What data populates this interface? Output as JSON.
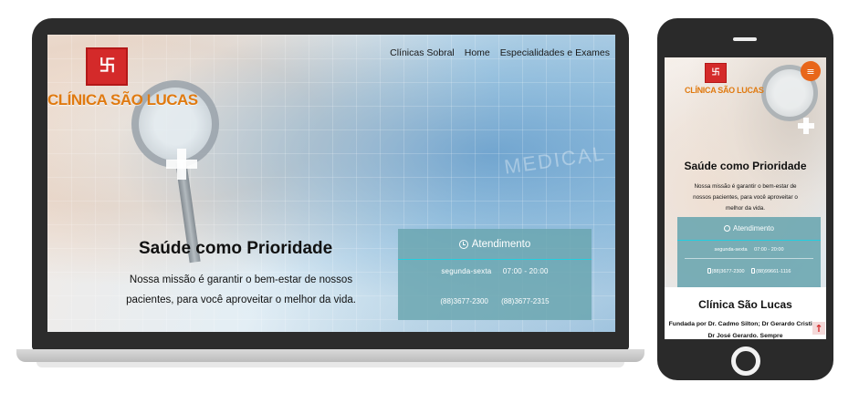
{
  "desktop": {
    "logo": {
      "glyph": "卐",
      "text": "CLÍNICA SÃO LUCAS"
    },
    "nav": [
      {
        "label": "Clínicas Sobral"
      },
      {
        "label": "Home"
      },
      {
        "label": "Especialidades e Exames"
      }
    ],
    "hero": {
      "title": "Saúde como Prioridade",
      "description": "Nossa missão é garantir o bem-estar de nossos pacientes, para você aproveitar o melhor da vida.",
      "watermark": "MEDICAL"
    },
    "atendimento": {
      "title": "Atendimento",
      "days": "segunda-sexta",
      "hours": "07:00 - 20:00",
      "phone1": "(88)3677-2300",
      "phone2": "(88)3677-2315"
    }
  },
  "mobile": {
    "logo": {
      "glyph": "卐",
      "text": "CLÍNICA SÃO LUCAS"
    },
    "menu_icon": "≡",
    "hero": {
      "title": "Saúde como Prioridade",
      "description": "Nossa missão é garantir o bem-estar de nossos pacientes, para você aproveitar o melhor da vida."
    },
    "atendimento": {
      "title": "Atendimento",
      "days": "segunda-sexta",
      "hours": "07:00 - 20:00",
      "phone1": "(88)3677-2300",
      "phone2": "(88)99661-1116"
    },
    "about": {
      "title": "Clínica São Lucas",
      "text": "Fundada por Dr. Cadmo Silton; Dr Gerardo Cristino; Dr José Gerardo. Sempre"
    },
    "scroll_top_icon": "↑"
  },
  "colors": {
    "brand_red": "#d42a2a",
    "logo_orange": "#e07a10",
    "menu_orange": "#e8661a",
    "panel_teal": "#69a5af",
    "accent_cyan": "#22cfe0"
  },
  "icons": [
    "clock-icon",
    "phone-icon",
    "menu-icon",
    "arrow-up-icon",
    "logo-icon"
  ]
}
